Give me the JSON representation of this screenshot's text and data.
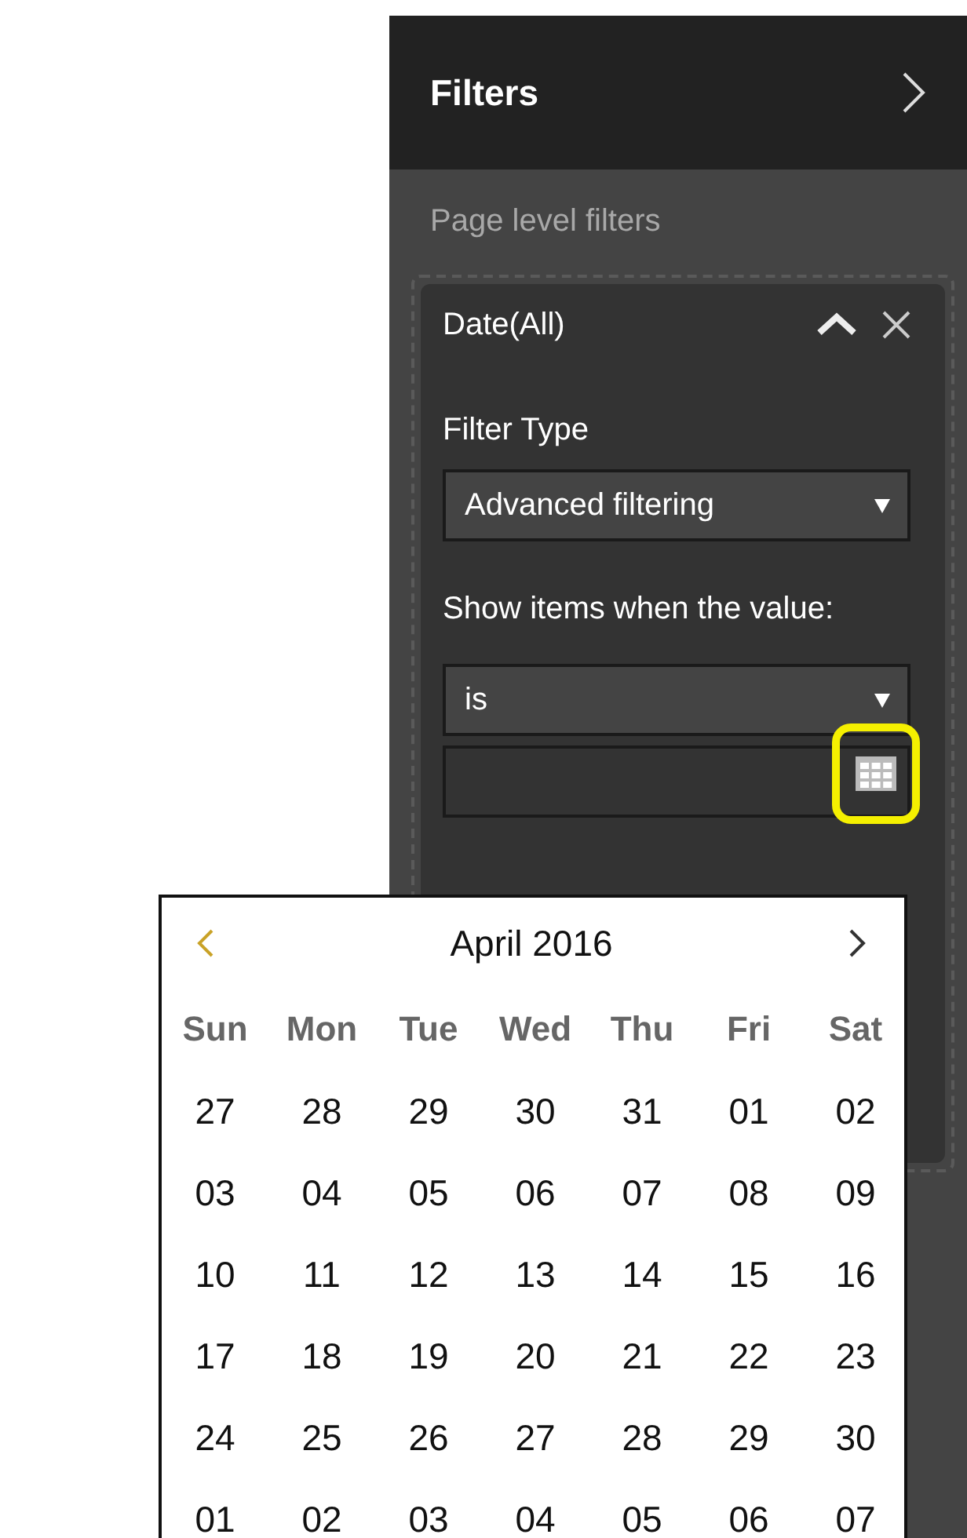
{
  "panel": {
    "title": "Filters",
    "section_label": "Page level filters",
    "filter_card": {
      "title": "Date(All)",
      "expanded": true,
      "filter_type_label": "Filter Type",
      "filter_type": {
        "value": "Advanced filtering"
      },
      "condition_label": "Show items when the value:",
      "condition": {
        "value": "is"
      },
      "date_field": {
        "highlighted": true
      }
    }
  },
  "calendar": {
    "month": "April 2016",
    "weekdays": [
      "Sun",
      "Mon",
      "Tue",
      "Wed",
      "Thu",
      "Fri",
      "Sat"
    ],
    "weeks": [
      [
        "27",
        "28",
        "29",
        "30",
        "31",
        "01",
        "02"
      ],
      [
        "03",
        "04",
        "05",
        "06",
        "07",
        "08",
        "09"
      ],
      [
        "10",
        "11",
        "12",
        "13",
        "14",
        "15",
        "16"
      ],
      [
        "17",
        "18",
        "19",
        "20",
        "21",
        "22",
        "23"
      ],
      [
        "24",
        "25",
        "26",
        "27",
        "28",
        "29",
        "30"
      ],
      [
        "01",
        "02",
        "03",
        "04",
        "05",
        "06",
        "07"
      ]
    ]
  }
}
